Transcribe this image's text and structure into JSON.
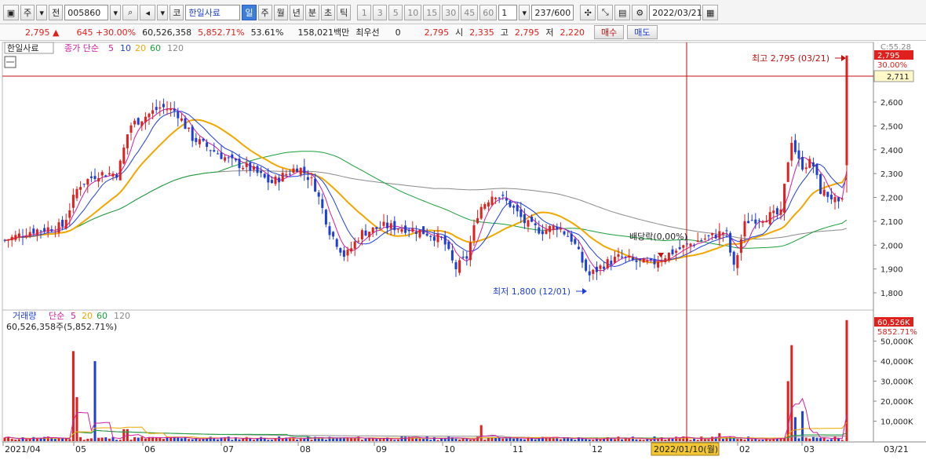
{
  "toolbar": {
    "type_label": "주",
    "prefix_label": "전",
    "code": "005860",
    "stock_name_prefix": "코",
    "stock_name": "한일사료",
    "periods": [
      "일",
      "주",
      "월",
      "년",
      "분",
      "초",
      "틱"
    ],
    "period_selected": "일",
    "intervals": [
      "1",
      "3",
      "5",
      "10",
      "15",
      "30",
      "45",
      "60"
    ],
    "interval_value": "1",
    "count": "237/600",
    "date": "2022/03/21"
  },
  "quote": {
    "price": "2,795",
    "price_arrow": "▲",
    "change": "645",
    "change_pct": "+30.00%",
    "volume": "60,526,358",
    "volume_pct": "5,852.71%",
    "turnover_pct": "53.61%",
    "trade_value": "158,021백만",
    "best_bid_label": "최우선",
    "best_bid": "0",
    "last": "2,795",
    "open_label": "시",
    "open": "2,335",
    "high_label": "고",
    "high": "2,795",
    "low_label": "저",
    "low": "2,220",
    "buy_label": "매수",
    "sell_label": "매도"
  },
  "price_panel": {
    "name": "한일사료",
    "ma_label": "종가 단순",
    "ma_periods": [
      "5",
      "10",
      "20",
      "60",
      "120"
    ],
    "high_annotation": "최고 2,795 (03/21)",
    "low_annotation": "최저 1,800 (12/01)",
    "dividend_annotation": "배당락(0,00%)",
    "last_tag": "2,795",
    "pct_tag": "30.00%",
    "c_tag": "C:55.28",
    "line_tag": "2,711",
    "y_ticks": [
      "2,600",
      "2,500",
      "2,400",
      "2,300",
      "2,200",
      "2,100",
      "2,000",
      "1,900",
      "1,800"
    ]
  },
  "volume_panel": {
    "title": "거래량",
    "ma_label": "단순",
    "ma_periods": [
      "5",
      "20",
      "60",
      "120"
    ],
    "value_line": "60,526,358주(5,852.71%)",
    "last_tag": "60,526K",
    "pct_tag": "5852.71%",
    "y_ticks": [
      "50,000K",
      "40,000K",
      "30,000K",
      "20,000K",
      "10,000K"
    ]
  },
  "x_axis": {
    "labels": [
      "2021/04",
      "05",
      "06",
      "07",
      "08",
      "09",
      "10",
      "11",
      "12",
      "01",
      "02",
      "03"
    ],
    "cursor_date": "2022/01/10(월)",
    "right_label": "03/21"
  },
  "colors": {
    "up": "#e0201c",
    "down": "#1d3fd8",
    "ma5": "#d01ea0",
    "ma10": "#1d3fd8",
    "ma20": "#f0a800",
    "ma60": "#1a9e3a",
    "ma120": "#8a8a8a"
  }
}
